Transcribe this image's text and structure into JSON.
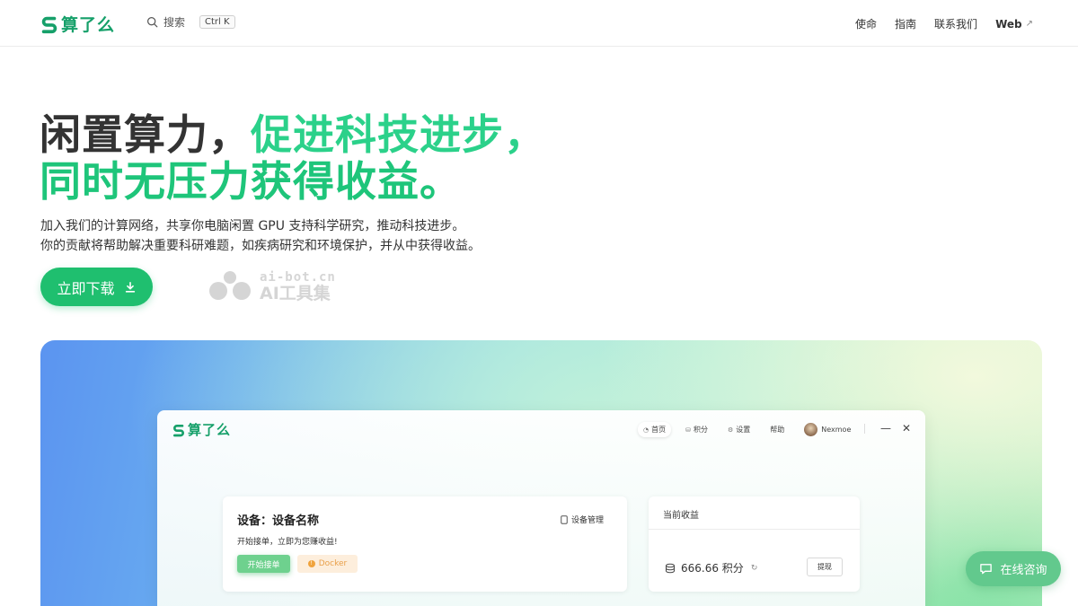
{
  "header": {
    "brand": "算了么",
    "search_label": "搜索",
    "search_shortcut": "Ctrl K",
    "nav": [
      {
        "label": "使命"
      },
      {
        "label": "指南"
      },
      {
        "label": "联系我们"
      },
      {
        "label": "Web"
      }
    ],
    "web_arrow": "↗"
  },
  "hero": {
    "title_line1_dark": "闲置算力，",
    "title_line1_green": "促进科技进步，",
    "title_line2": "同时无压力获得收益。",
    "desc_line1": "加入我们的计算网络，共享你电脑闲置 GPU 支持科学研究，推动科技进步。",
    "desc_line2": "你的贡献将帮助解决重要科研难题，如疾病研究和环境保护，并从中获得收益。",
    "download_label": "立即下载"
  },
  "watermark": {
    "url": "ai-bot.cn",
    "name": "AI工具集"
  },
  "app_preview": {
    "brand": "算了么",
    "nav": [
      {
        "label": "首页",
        "icon": "home-icon"
      },
      {
        "label": "积分",
        "icon": "coins-icon"
      },
      {
        "label": "设置",
        "icon": "gear-icon"
      },
      {
        "label": "帮助"
      }
    ],
    "user_name": "Nexmoe",
    "minimize": "—",
    "close": "✕",
    "device_card": {
      "title": "设备：设备名称",
      "manage_label": "设备管理",
      "subtitle": "开始接单，立即为您赚收益!",
      "start_label": "开始接单",
      "docker_label": "Docker"
    },
    "earnings_card": {
      "title": "当前收益",
      "value": "666.66 积分",
      "withdraw_label": "提现"
    }
  },
  "chat_button": {
    "label": "在线咨询"
  },
  "colors": {
    "brand_green": "#16a06a",
    "accent_green": "#2bd18a",
    "button_green": "#1fbf6f"
  }
}
